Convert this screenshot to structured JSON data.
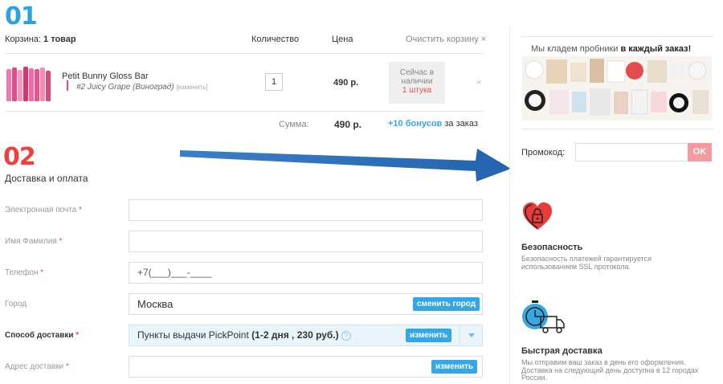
{
  "step1_number": "01",
  "step2_number": "02",
  "cart": {
    "label": "Корзина:",
    "count": "1 товар",
    "col_quantity": "Количество",
    "col_price": "Цена",
    "clear_label": "Очистить корзину ×",
    "item": {
      "name": "Petit Bunny Gloss Bar",
      "variant": "#2 Juicy Grape (Виноград)",
      "change_link": "[изменить]",
      "quantity": "1",
      "price": "490 р.",
      "stock_line1": "Сейчас в",
      "stock_line2": "наличии",
      "stock_count": "1 штука",
      "remove": "×"
    },
    "sum_label": "Сумма:",
    "sum_value": "490 р.",
    "bonus_text": "+10 бонусов",
    "bonus_suffix": "за заказ"
  },
  "delivery": {
    "title": "Доставка и оплата",
    "email_label": "Электронная почта",
    "name_label": "Имя Фамилия",
    "phone_label": "Телефон",
    "phone_value": "+7(___)___-____",
    "city_label": "Город",
    "city_value": "Москва",
    "change_city_btn": "сменить город",
    "method_label": "Способ доставки",
    "method_value": "Пункты выдачи PickPoint",
    "method_detail": "(1-2 дня , 230 руб.)",
    "method_change_btn": "изменить",
    "address_label": "Адрес доставки",
    "address_change_btn": "изменить",
    "required_mark": "*"
  },
  "sidebar": {
    "samples_text": "Мы кладем пробники",
    "samples_bold": "в каждый заказ!",
    "promo_label": "Промокод:",
    "promo_ok": "OK",
    "security_title": "Безопасность",
    "security_desc": "Безопасность платежей гарантируется использованием SSL протокола.",
    "delivery_title": "Быстрая доставка",
    "delivery_desc": "Мы отправим ваш заказ в день его оформления. Доставка на следующий день доступна в 12 городах России."
  },
  "colors": {
    "accent_blue": "#35a7e8",
    "accent_red": "#ef3f3f",
    "ok_pink": "#f59aa0",
    "arrow_blue": "#2f6fb7"
  },
  "icons": [
    "lock-heart-icon",
    "delivery-truck-icon",
    "help-circle-icon",
    "dropdown-arrow-icon"
  ]
}
